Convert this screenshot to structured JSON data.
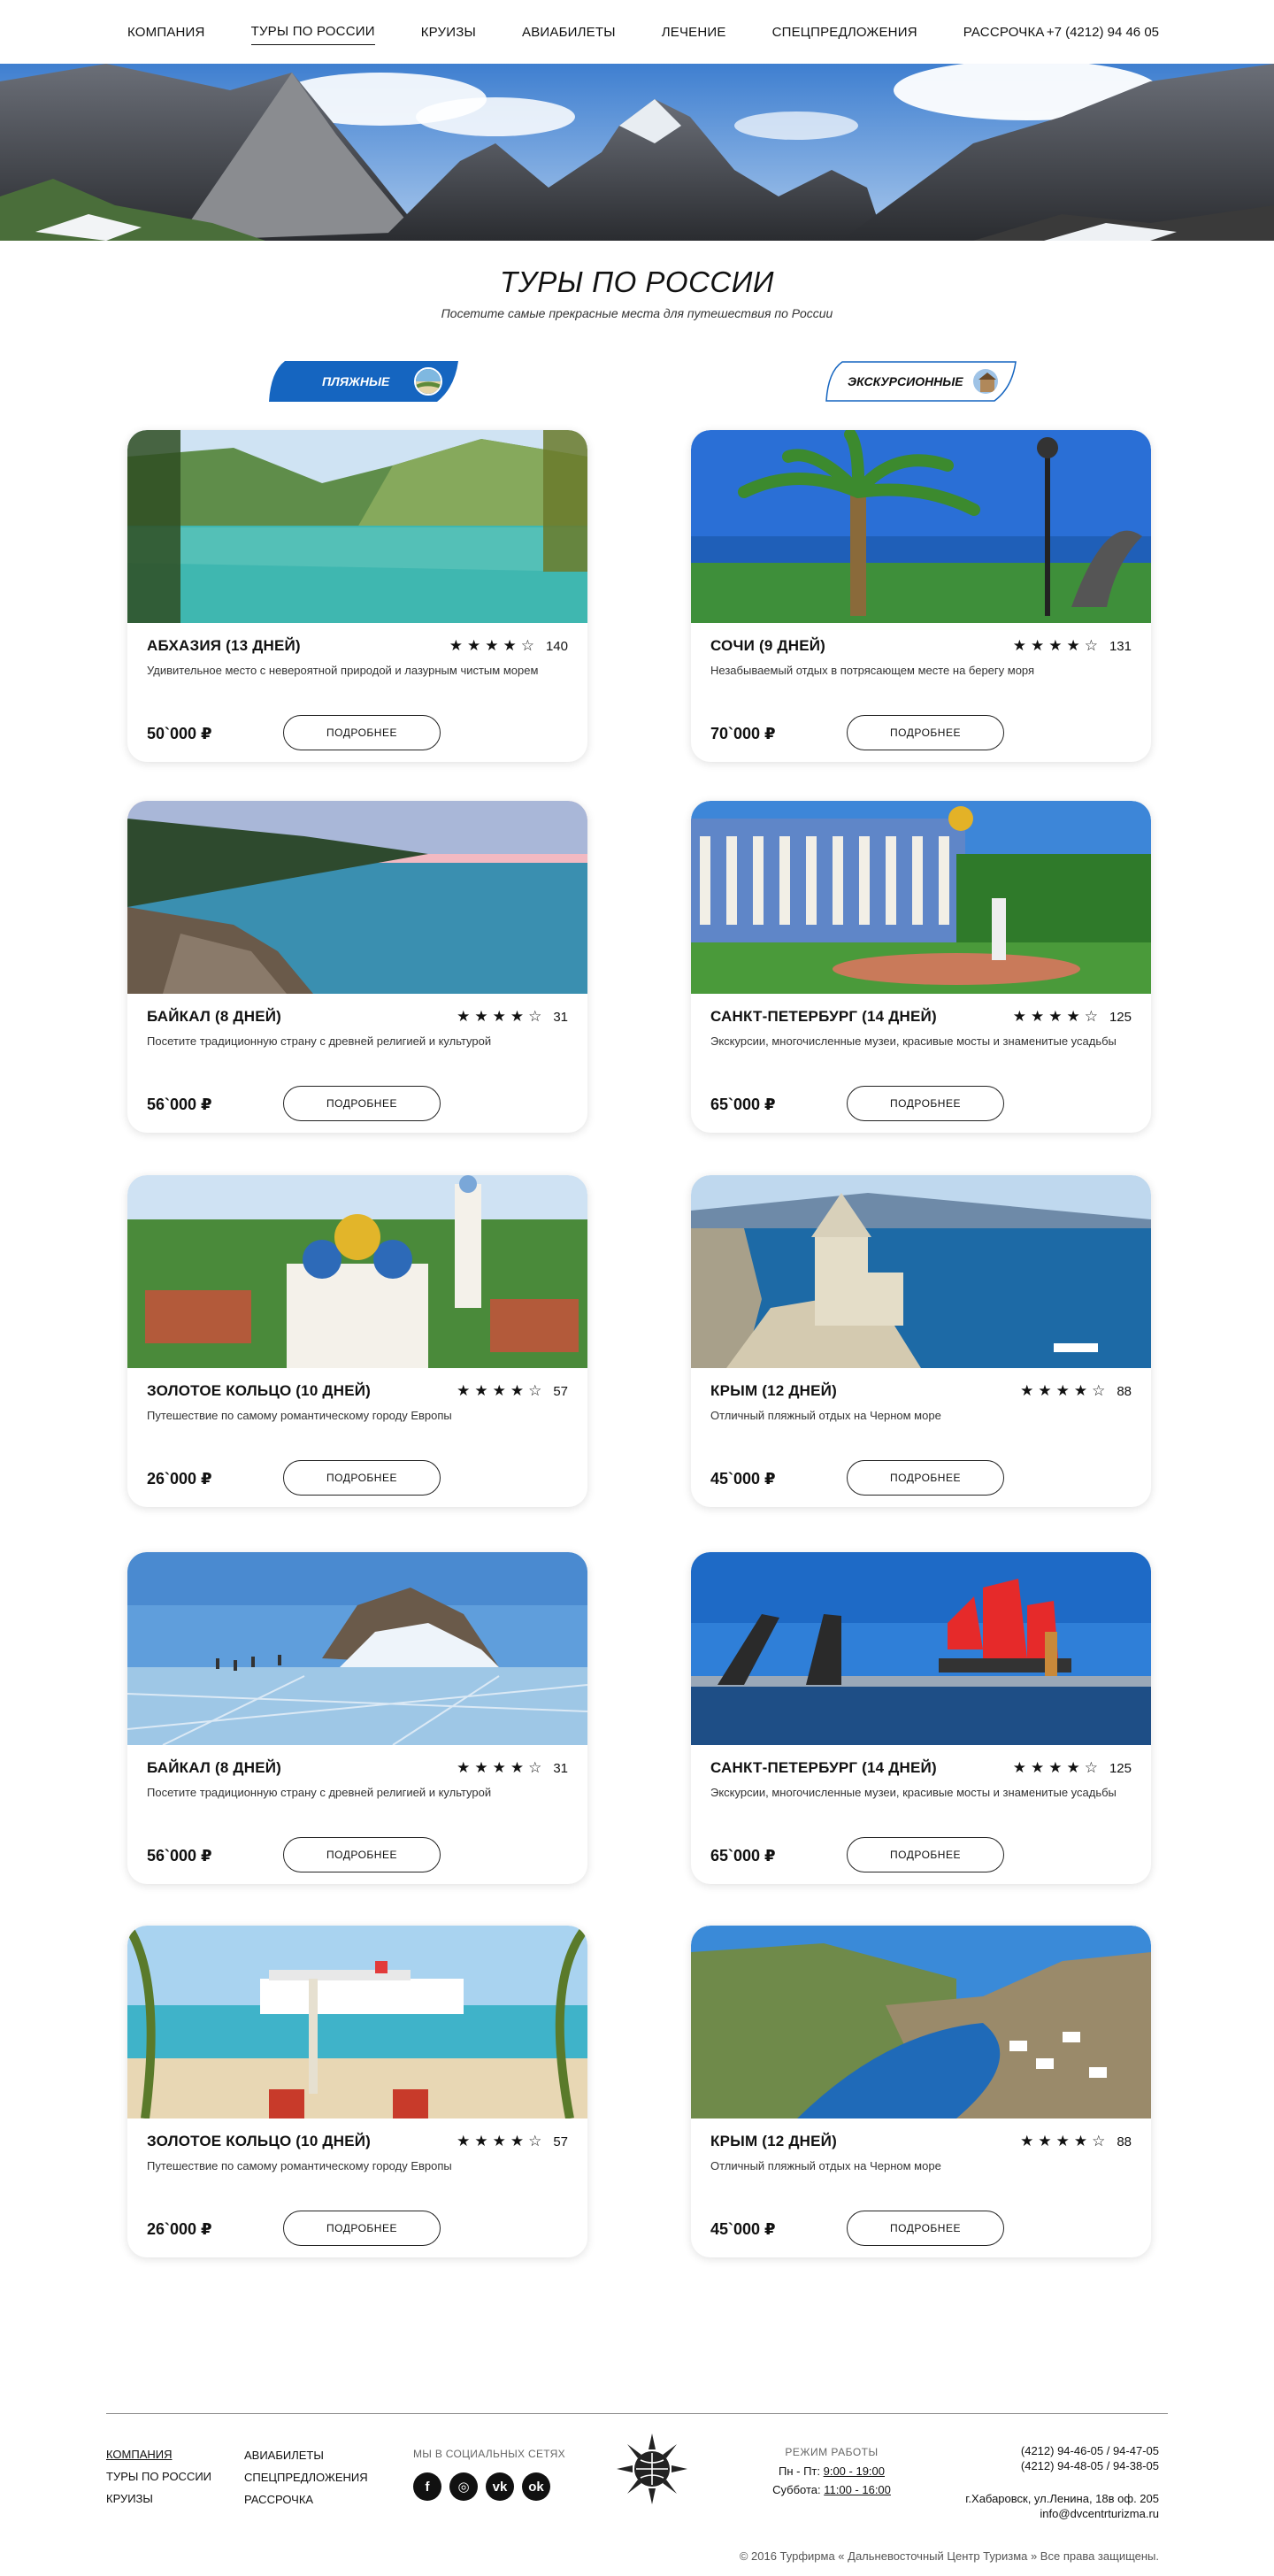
{
  "nav": {
    "items": [
      {
        "label": "КОМПАНИЯ",
        "active": false
      },
      {
        "label": "ТУРЫ ПО РОССИИ",
        "active": true
      },
      {
        "label": "КРУИЗЫ",
        "active": false
      },
      {
        "label": "АВИАБИЛЕТЫ",
        "active": false
      },
      {
        "label": "ЛЕЧЕНИЕ",
        "active": false
      },
      {
        "label": "СПЕЦПРЕДЛОЖЕНИЯ",
        "active": false
      },
      {
        "label": "РАССРОЧКА",
        "active": false
      }
    ],
    "phone": "+7 (4212) 94 46 05"
  },
  "page": {
    "title": "ТУРЫ ПО РОССИИ",
    "subtitle": "Посетите самые прекрасные места для путешествия по России"
  },
  "filters": {
    "beach": "ПЛЯЖНЫЕ",
    "excursion": "ЭКСКУРСИОННЫЕ"
  },
  "colors": {
    "accent": "#1565c0"
  },
  "button_label": "ПОДРОБНЕЕ",
  "tours": [
    {
      "title": "АБХАЗИЯ (13 ДНЕЙ)",
      "stars": "★★★★☆",
      "reviews": "140",
      "desc": "Удивительное место с невероятной природой и лазурным чистым морем",
      "price": "50`000 ₽",
      "image": "lake"
    },
    {
      "title": "СОЧИ (9 ДНЕЙ)",
      "stars": "★★★★☆",
      "reviews": "131",
      "desc": "Незабываемый отдых в потрясающем месте на берегу моря",
      "price": "70`000 ₽",
      "image": "palm"
    },
    {
      "title": "БАЙКАЛ (8 ДНЕЙ)",
      "stars": "★★★★☆",
      "reviews": "31",
      "desc": "Посетите традиционную страну с древней  религией и культурой",
      "price": "56`000 ₽",
      "image": "baikal"
    },
    {
      "title": "САНКТ-ПЕТЕРБУРГ (14 ДНЕЙ)",
      "stars": "★★★★☆",
      "reviews": "125",
      "desc": "Экскурсии, многочисленные музеи, красивые мосты и знаменитые усадьбы",
      "price": "65`000 ₽",
      "image": "palace"
    },
    {
      "title": "ЗОЛОТОЕ КОЛЬЦО (10 ДНЕЙ)",
      "stars": "★★★★☆",
      "reviews": "57",
      "desc": "Путешествие по самому романтическому городу Европы",
      "price": "26`000 ₽",
      "image": "church"
    },
    {
      "title": "КРЫМ (12 ДНЕЙ)",
      "stars": "★★★★☆",
      "reviews": "88",
      "desc": "Отличный пляжный отдых на Черном море",
      "price": "45`000 ₽",
      "image": "castle"
    },
    {
      "title": "БАЙКАЛ (8 ДНЕЙ)",
      "stars": "★★★★☆",
      "reviews": "31",
      "desc": "Посетите традиционную страну с древней  религией и культурой",
      "price": "56`000 ₽",
      "image": "ice"
    },
    {
      "title": "САНКТ-ПЕТЕРБУРГ (14 ДНЕЙ)",
      "stars": "★★★★☆",
      "reviews": "125",
      "desc": "Экскурсии, многочисленные музеи, красивые мосты и знаменитые усадьбы",
      "price": "65`000 ₽",
      "image": "sails"
    },
    {
      "title": "ЗОЛОТОЕ КОЛЬЦО (10 ДНЕЙ)",
      "stars": "★★★★☆",
      "reviews": "57",
      "desc": "Путешествие по самому романтическому городу Европы",
      "price": "26`000 ₽",
      "image": "beach"
    },
    {
      "title": "КРЫМ (12 ДНЕЙ)",
      "stars": "★★★★☆",
      "reviews": "88",
      "desc": "Отличный пляжный отдых на Черном море",
      "price": "45`000 ₽",
      "image": "bay"
    }
  ],
  "footer": {
    "col1": [
      "КОМПАНИЯ",
      "ТУРЫ ПО РОССИИ",
      "КРУИЗЫ"
    ],
    "col2": [
      "АВИАБИЛЕТЫ",
      "СПЕЦПРЕДЛОЖЕНИЯ",
      "РАССРОЧКА"
    ],
    "social_title": "МЫ В СОЦИАЛЬНЫХ СЕТЯХ",
    "social": [
      {
        "name": "facebook-icon",
        "glyph": "f"
      },
      {
        "name": "instagram-icon",
        "glyph": "◎"
      },
      {
        "name": "vk-icon",
        "glyph": "vk"
      },
      {
        "name": "odnoklassniki-icon",
        "glyph": "ok"
      }
    ],
    "hours_title": "РЕЖИМ РАБОТЫ",
    "hours_weekdays_label": "Пн - Пт: ",
    "hours_weekdays": "9:00 - 19:00",
    "hours_saturday_label": "Суббота: ",
    "hours_saturday": "11:00 - 16:00",
    "phone1": "(4212) 94-46-05 / 94-47-05",
    "phone2": "(4212) 94-48-05 / 94-38-05",
    "address": "г.Хабаровск, ул.Ленина, 18в оф. 205",
    "email": "info@dvcentrturizma.ru",
    "copyright": "© 2016 Турфирма « Дальневосточный Центр Туризма » Все права защищены."
  }
}
